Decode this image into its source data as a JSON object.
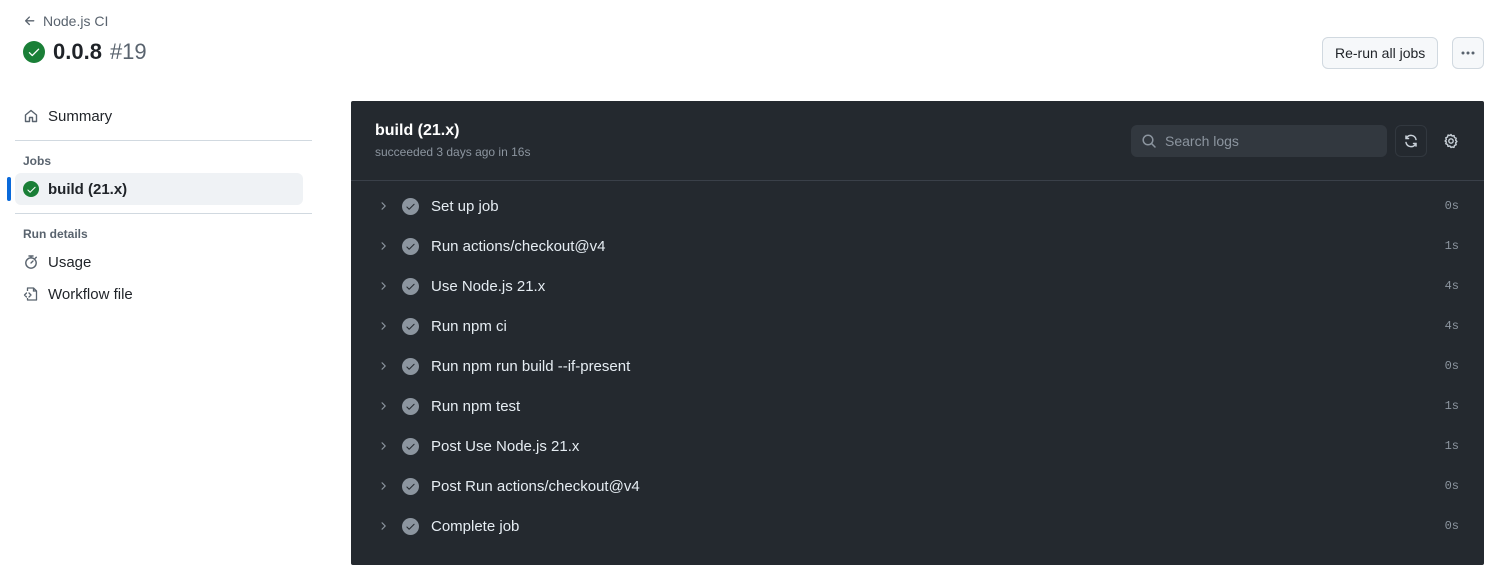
{
  "header": {
    "back_label": "Node.js CI",
    "run_title": "0.0.8",
    "run_number": "#19",
    "status": "success",
    "rerun_label": "Re-run all jobs",
    "more_icon": "kebab-horizontal-icon"
  },
  "sidebar": {
    "summary_label": "Summary",
    "jobs_heading": "Jobs",
    "jobs": [
      {
        "label": "build (21.x)",
        "status": "success",
        "active": true
      }
    ],
    "run_details_heading": "Run details",
    "details": [
      {
        "label": "Usage",
        "icon": "stopwatch-icon"
      },
      {
        "label": "Workflow file",
        "icon": "file-code-icon"
      }
    ]
  },
  "job": {
    "name": "build (21.x)",
    "status_text": "succeeded 3 days ago in 16s",
    "search_placeholder": "Search logs",
    "steps": [
      {
        "name": "Set up job",
        "duration": "0s"
      },
      {
        "name": "Run actions/checkout@v4",
        "duration": "1s"
      },
      {
        "name": "Use Node.js 21.x",
        "duration": "4s"
      },
      {
        "name": "Run npm ci",
        "duration": "4s"
      },
      {
        "name": "Run npm run build --if-present",
        "duration": "0s"
      },
      {
        "name": "Run npm test",
        "duration": "1s"
      },
      {
        "name": "Post Use Node.js 21.x",
        "duration": "1s"
      },
      {
        "name": "Post Run actions/checkout@v4",
        "duration": "0s"
      },
      {
        "name": "Complete job",
        "duration": "0s"
      }
    ]
  },
  "colors": {
    "success": "#1a7f37",
    "accent": "#0969da",
    "log_bg": "#24292f"
  }
}
